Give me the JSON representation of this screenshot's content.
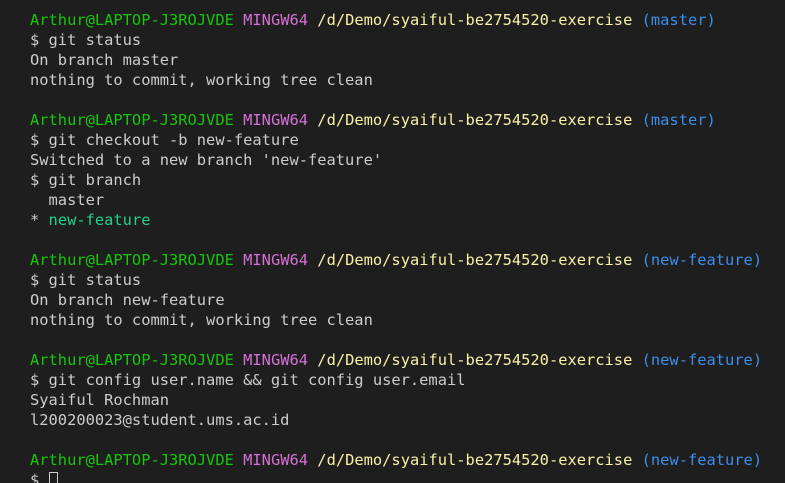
{
  "prompt": {
    "user_host": "Arthur@LAPTOP-J3ROJVDE",
    "system": "MINGW64",
    "path": "/d/Demo/syaiful-be2754520-exercise",
    "branch_master": "(master)",
    "branch_feature": "(new-feature)",
    "symbol": "$"
  },
  "commands": {
    "status": "$ git status",
    "checkout": "$ git checkout -b new-feature",
    "branch": "$ git branch",
    "config": "$ git config user.name && git config user.email",
    "final": "$ "
  },
  "output": {
    "on_master": "On branch master",
    "clean": "nothing to commit, working tree clean",
    "switched": "Switched to a new branch 'new-feature'",
    "branch_list_master": "  master",
    "branch_list_current_marker": "* ",
    "branch_list_current": "new-feature",
    "on_feature": "On branch new-feature",
    "user_name": "Syaiful Rochman",
    "user_email": "l200200023@student.ums.ac.id"
  },
  "colors": {
    "background": "#1e1e1e",
    "text": "#cccccc",
    "user_host": "#16c60c",
    "system": "#d670d6",
    "path": "#f9f1a5",
    "branch": "#3b8eea",
    "current_branch": "#23d18b"
  }
}
